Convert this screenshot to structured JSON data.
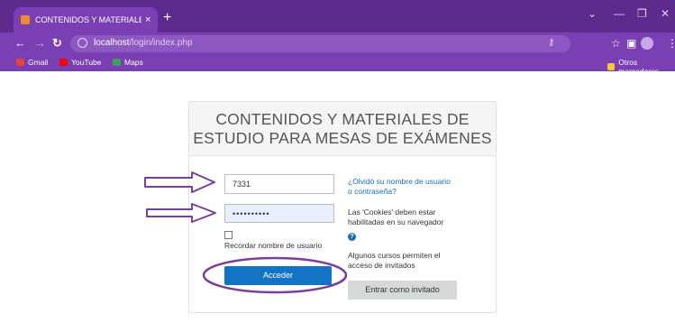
{
  "browser": {
    "tab_title": "CONTENIDOS Y MATERIALES DE",
    "tab_close": "×",
    "new_tab": "+",
    "url_host": "localhost",
    "url_path": "/login/index.php",
    "win_minimize": "—",
    "win_maximize": "❐",
    "win_close": "✕",
    "win_chevron": "⌄",
    "bookmarks": [
      {
        "label": "Gmail",
        "color": "#ea4335"
      },
      {
        "label": "YouTube",
        "color": "#ff0000"
      },
      {
        "label": "Maps",
        "color": "#34a853"
      }
    ],
    "other_bookmarks": "Otros marcadores"
  },
  "login": {
    "title_line1": "CONTENIDOS Y MATERIALES DE",
    "title_line2": "ESTUDIO PARA MESAS DE EXÁMENES",
    "username_value": "7331",
    "password_value": "••••••••••",
    "remember_label": "Recordar nombre de usuario",
    "login_button": "Acceder",
    "forgot_line1": "¿Olvidó su nombre de usuario",
    "forgot_line2": "o contraseña?",
    "cookies_line1": "Las 'Cookies' deben estar",
    "cookies_line2": "habilitadas en su navegador",
    "help_icon": "?",
    "guests_line1": "Algunos cursos permiten el",
    "guests_line2": "acceso de invitados",
    "guest_button": "Entrar como invitado"
  },
  "colors": {
    "browser_frame": "#5d2a8e",
    "toolbar": "#7b3fb4",
    "login_button": "#1374c6",
    "annotation": "#7b3e9a"
  }
}
